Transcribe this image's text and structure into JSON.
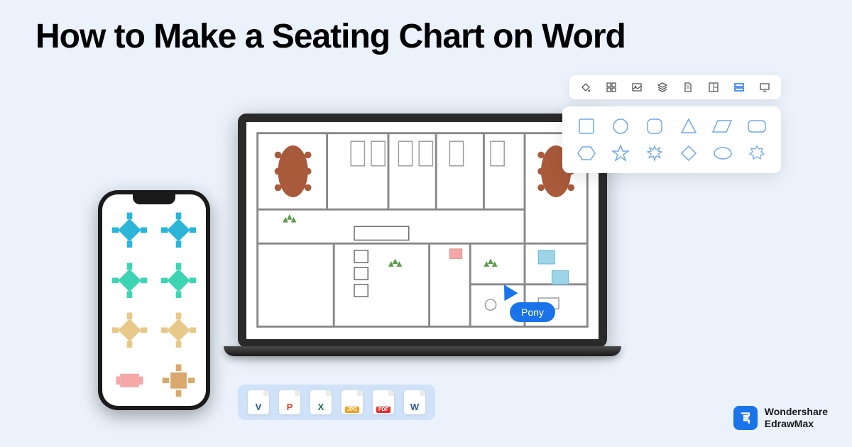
{
  "title": "How to Make a Seating Chart on Word",
  "cursor_label": "Pony",
  "formats": [
    {
      "letter": "V",
      "short": "",
      "letterColor": "#2b5797",
      "badgeColor": "#2b5797"
    },
    {
      "letter": "P",
      "short": "",
      "letterColor": "#d24726",
      "badgeColor": "#d24726"
    },
    {
      "letter": "X",
      "short": "",
      "letterColor": "#217346",
      "badgeColor": "#217346"
    },
    {
      "letter": "",
      "short": "JPG",
      "letterColor": "#333",
      "badgeColor": "#f0a020"
    },
    {
      "letter": "",
      "short": "PDF",
      "letterColor": "#333",
      "badgeColor": "#e03131"
    },
    {
      "letter": "W",
      "short": "",
      "letterColor": "#2b5797",
      "badgeColor": "#2b5797"
    }
  ],
  "brand": {
    "line1": "Wondershare",
    "line2": "EdrawMax"
  },
  "toolbar_icons": [
    "paint-bucket-icon",
    "grid-icon",
    "image-icon",
    "layers-icon",
    "page-icon",
    "layout-icon",
    "shapes-icon",
    "presentation-icon"
  ],
  "shapes": {
    "row1": [
      "square",
      "circle",
      "rounded-square",
      "triangle",
      "parallelogram",
      "rounded-rect"
    ],
    "row2": [
      "hexagon",
      "star",
      "burst",
      "diamond",
      "ellipse",
      "multi-star"
    ]
  },
  "phone_tables": [
    {
      "color": "#2bb5d9"
    },
    {
      "color": "#2bb5d9"
    },
    {
      "color": "#3dd4b3"
    },
    {
      "color": "#3dd4b3"
    },
    {
      "color": "#e8c98a"
    },
    {
      "color": "#e8c98a"
    },
    {
      "color": "#f4a8a8"
    },
    {
      "color": "#d9a86c"
    }
  ]
}
